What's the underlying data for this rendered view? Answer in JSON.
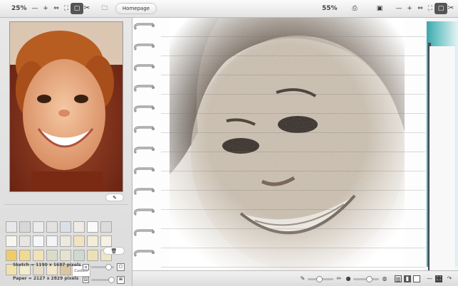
{
  "toolbar_left": {
    "zoom": "25%",
    "home_label": "Homepage"
  },
  "toolbar_right": {
    "zoom": "55%"
  },
  "left_panel": {
    "custom_label": "Custom",
    "sketch_size": "Sketch = 1190 x 1687 pixels",
    "paper_size": "Paper = 2127 x 2829 pixels"
  },
  "paper_swatches": [
    "#e8e8e8",
    "#d7d7d7",
    "#ececec",
    "#e2e2e2",
    "#d9e0e6",
    "#f0ece4",
    "#fafafa",
    "#dcdcdc",
    "#f7f6ee",
    "#e7e6e0",
    "#f6f7fa",
    "#f4f4f6",
    "#eceae0",
    "#f1e3c0",
    "#f3ecd6",
    "#f5f1e4",
    "#f0cc68",
    "#f2d991",
    "#f1e2b8",
    "#d9dcc8",
    "#e5e3cf",
    "#cfd9cd",
    "#ece1b5",
    "#ebe6c9",
    "#f1e1ac",
    "#f4ecce",
    "#e6dcc4",
    "#f2e7c9",
    "#dbc6a2"
  ],
  "colors": {
    "accent_teal": "#3aa7ac"
  }
}
